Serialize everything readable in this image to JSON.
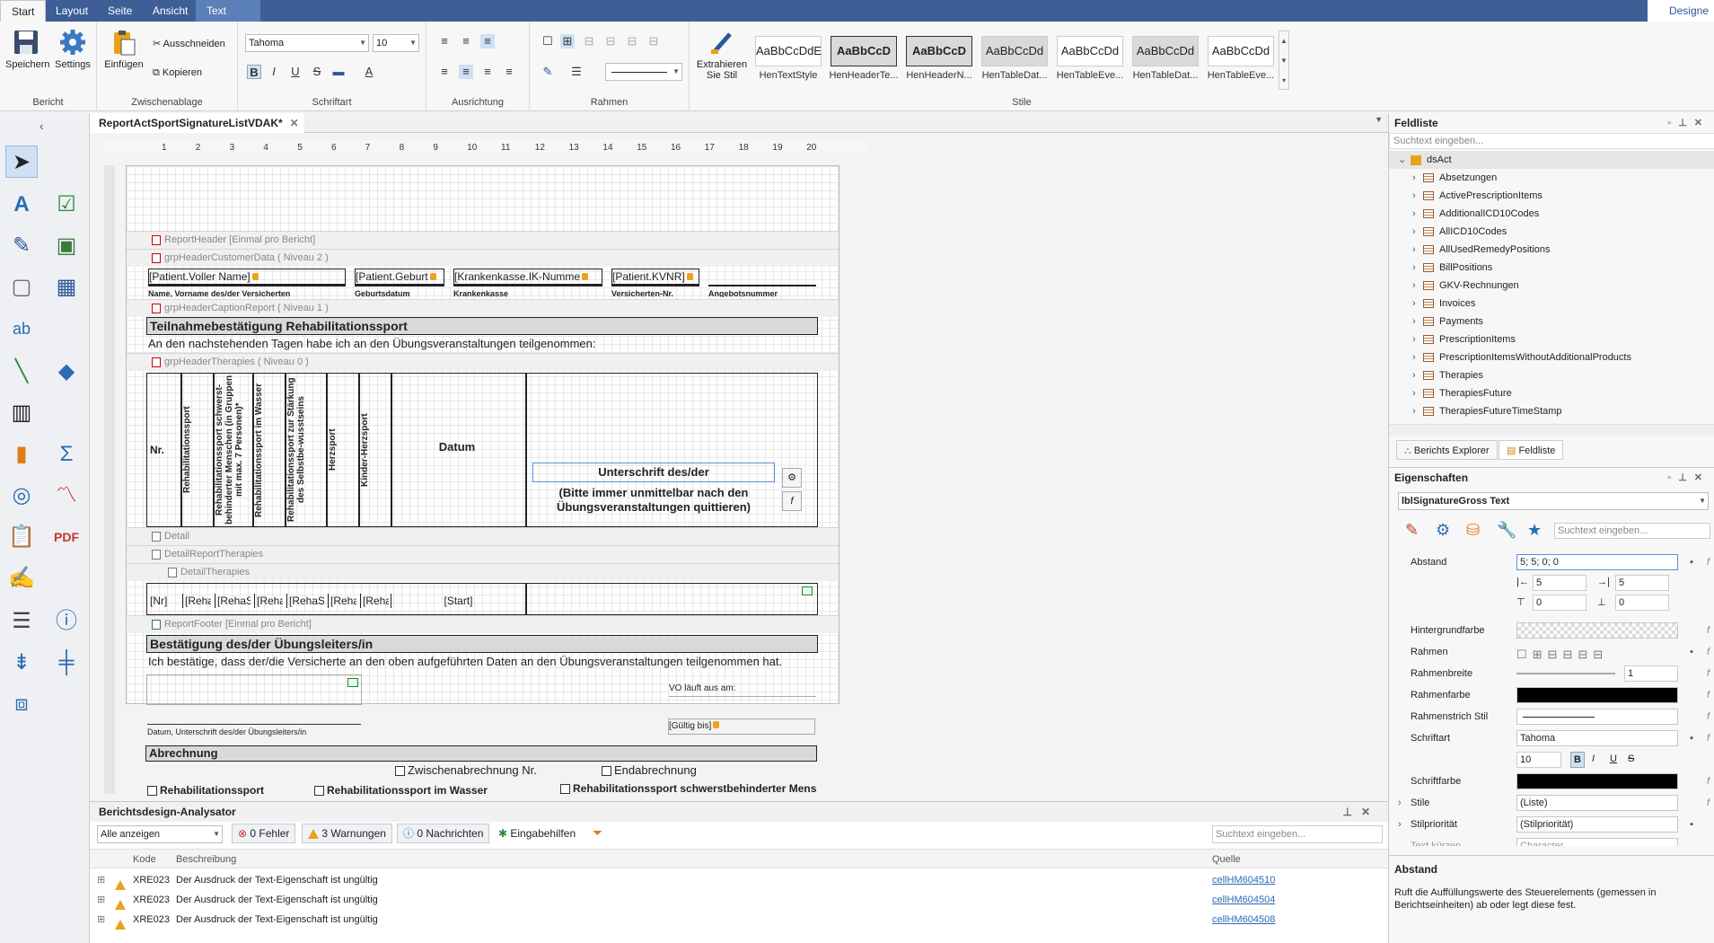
{
  "tabs": {
    "start": "Start",
    "layout": "Layout",
    "seite": "Seite",
    "ansicht": "Ansicht",
    "text": "Text",
    "designer": "Designe"
  },
  "ribbon": {
    "bericht": {
      "speichern": "Speichern",
      "settings": "Settings",
      "label": "Bericht"
    },
    "zwischenablage": {
      "einfuegen": "Einfügen",
      "ausschneiden": "Ausschneiden",
      "kopieren": "Kopieren",
      "label": "Zwischenablage"
    },
    "schriftart": {
      "font": "Tahoma",
      "size": "10",
      "label": "Schriftart"
    },
    "ausrichtung": {
      "label": "Ausrichtung"
    },
    "rahmen": {
      "label": "Rahmen"
    },
    "extrahieren": {
      "line1": "Extrahieren",
      "line2": "Sie Stil"
    },
    "stile": {
      "label": "Stile",
      "items": [
        {
          "preview": "AaBbCcDdE",
          "name": "HenTextStyle"
        },
        {
          "preview": "AaBbCcD",
          "name": "HenHeaderTe..."
        },
        {
          "preview": "AaBbCcD",
          "name": "HenHeaderN..."
        },
        {
          "preview": "AaBbCcDd",
          "name": "HenTableDat..."
        },
        {
          "preview": "AaBbCcDd",
          "name": "HenTableEve..."
        },
        {
          "preview": "AaBbCcDd",
          "name": "HenTableDat..."
        },
        {
          "preview": "AaBbCcDd",
          "name": "HenTableEve..."
        }
      ]
    }
  },
  "document": {
    "tab": "ReportActSportSignatureListVDAK*"
  },
  "ruler": {
    "marks": [
      "1",
      "2",
      "3",
      "4",
      "5",
      "6",
      "7",
      "8",
      "9",
      "10",
      "11",
      "12",
      "13",
      "14",
      "15",
      "16",
      "17",
      "18",
      "19",
      "20"
    ]
  },
  "report": {
    "bands": {
      "reportHeader": "ReportHeader [Einmal pro Bericht]",
      "grpCustomer": "grpHeaderCustomerData ( Niveau 2 )",
      "grpCaption": "grpHeaderCaptionReport ( Niveau 1 )",
      "grpTherapies": "grpHeaderTherapies ( Niveau 0 )",
      "detail": "Detail",
      "detailReport": "DetailReportTherapies",
      "detailTherapies": "DetailTherapies",
      "reportFooter": "ReportFooter [Einmal pro Bericht]"
    },
    "customer": {
      "f1": "[Patient.Voller Name]",
      "f2": "[Patient.Geburt",
      "f3": "[Krankenkasse.IK-Numme",
      "f4": "[Patient.KVNR]",
      "l1": "Name, Vorname des/der Versicherten",
      "l2": "Geburtsdatum",
      "l3": "Krankenkasse",
      "l4": "Versicherten-Nr.",
      "l5": "Angebotsnummer"
    },
    "caption": {
      "title": "Teilnahmebestätigung     Rehabilitationssport",
      "text": "An den nachstehenden Tagen habe ich an den Übungsveranstaltungen teilgenommen:"
    },
    "table": {
      "nr": "Nr.",
      "c1": "Rehabilitationssport",
      "c2": "Rehabilitationssport schwerst-behinderter Menschen (in Gruppen mit max. 7 Personen)*",
      "c3": "Rehabilitationssport im Wasser",
      "c4": "Rehabilitationssport zur Stärkung des Selbstbe-wusstseins",
      "c5": "Herzsport",
      "c6": "Kinder-Herzsport",
      "datum": "Datum",
      "sig1": "Unterschrift des/der",
      "sig2": "(Bitte immer unmittelbar nach den Übungsveranstaltungen quittieren)"
    },
    "detail": {
      "nr": "[Nr]",
      "r1": "[Reha",
      "r2": "[RehaSch",
      "r3": "[Reha",
      "r4": "[RehaSel",
      "r5": "[Reha",
      "r6": "[Reha",
      "start": "[Start]"
    },
    "footer": {
      "title": "Bestätigung des/der Übungsleiters/in",
      "text": "Ich bestätige, dass der/die Versicherte an den oben aufgeführten Daten an den Übungsveranstaltungen teilgenommen hat.",
      "sign": "Datum, Unterschrift des/der Übungsleiters/in",
      "vo": "VO läuft aus am:",
      "gueltig": "[Gültig bis]",
      "abrechnung": "Abrechnung",
      "zwischen": "Zwischenabrechnung Nr.",
      "end": "Endabrechnung",
      "cb1": "Rehabilitationssport",
      "cb2": "Rehabilitationssport im Wasser",
      "cb3": "Rehabilitationssport schwerstbehinderter Mensch"
    }
  },
  "fieldlist": {
    "title": "Feldliste",
    "search": "Suchtext eingeben...",
    "root": "dsAct",
    "items": [
      "Absetzungen",
      "ActivePrescriptionItems",
      "AdditionalICD10Codes",
      "AllICD10Codes",
      "AllUsedRemedyPositions",
      "BillPositions",
      "GKV-Rechnungen",
      "Invoices",
      "Payments",
      "PrescriptionItems",
      "PrescriptionItemsWithoutAdditionalProducts",
      "Therapies",
      "TherapiesFuture",
      "TherapiesFutureTimeStamp"
    ],
    "tabExplorer": "Berichts Explorer",
    "tabFeld": "Feldliste"
  },
  "properties": {
    "title": "Eigenschaften",
    "selected": "lblSignatureGross  Text",
    "search": "Suchtext eingeben...",
    "abstand": {
      "label": "Abstand",
      "value": "5; 5; 0; 0",
      "l": "5",
      "r": "5",
      "t": "0",
      "b": "0"
    },
    "rows": [
      {
        "label": "Hintergrundfarbe",
        "value": ""
      },
      {
        "label": "Rahmen",
        "value": ""
      },
      {
        "label": "Rahmenbreite",
        "value": "1"
      },
      {
        "label": "Rahmenfarbe",
        "value": ""
      },
      {
        "label": "Rahmenstrich Stil",
        "value": ""
      },
      {
        "label": "Schriftart",
        "value": "Tahoma"
      },
      {
        "label": "",
        "value": "10"
      },
      {
        "label": "Schriftfarbe",
        "value": ""
      },
      {
        "label": "Stile",
        "value": "(Liste)"
      },
      {
        "label": "Stilpriorität",
        "value": "(Stilpriorität)"
      },
      {
        "label": "Text kürzen",
        "value": "Character"
      }
    ],
    "descTitle": "Abstand",
    "descText": "Ruft die Auffüllungswerte des Steuerelements (gemessen in Berichtseinheiten) ab oder legt diese fest."
  },
  "analyzer": {
    "title": "Berichtsdesign-Analysator",
    "filter": "Alle anzeigen",
    "errors": "0 Fehler",
    "warnings": "3 Warnungen",
    "messages": "0 Nachrichten",
    "help": "Eingabehilfen",
    "search": "Suchtext eingeben...",
    "colKode": "Kode",
    "colDesc": "Beschreibung",
    "colSrc": "Quelle",
    "rows": [
      {
        "code": "XRE023",
        "desc": "Der Ausdruck der Text-Eigenschaft ist ungültig",
        "src": "cellHM604510"
      },
      {
        "code": "XRE023",
        "desc": "Der Ausdruck der Text-Eigenschaft ist ungültig",
        "src": "cellHM604504"
      },
      {
        "code": "XRE023",
        "desc": "Der Ausdruck der Text-Eigenschaft ist ungültig",
        "src": "cellHM604508"
      }
    ]
  },
  "colors": {
    "tabbar": "#3d5f95",
    "accent": "#2b579a",
    "warning": "#e7a31a",
    "headerBar": "#d9d9d9"
  }
}
